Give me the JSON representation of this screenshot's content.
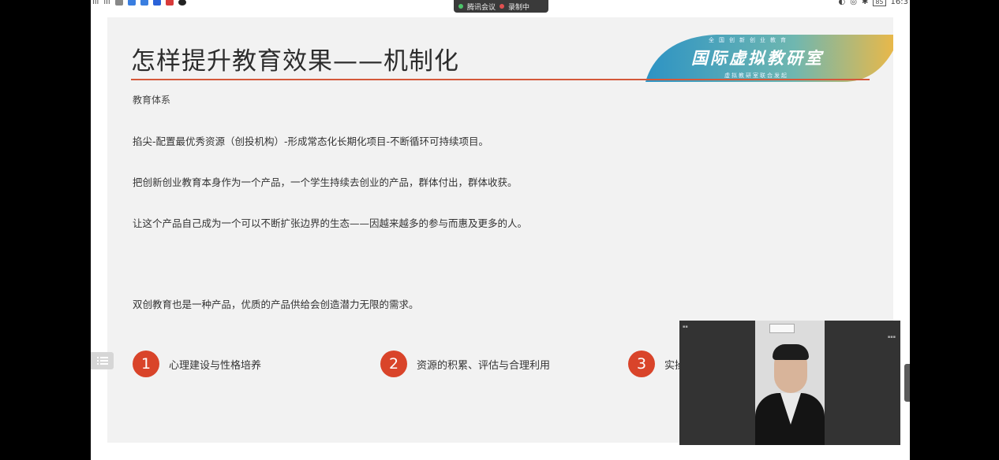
{
  "statusbar": {
    "left_signal": "ıll",
    "left_signal2": "ıll",
    "meeting_app": "腾讯会议",
    "recording": "录制中",
    "battery": "85",
    "time": "16:3"
  },
  "slide": {
    "title": "怎样提升教育效果——机制化",
    "banner": {
      "main": "国际虚拟教研室",
      "top": "全国创新创业教育",
      "bottom": "虚拟教研室联合发起"
    },
    "heading": "教育体系",
    "paragraphs": [
      "掐尖-配置最优秀资源（创投机构）-形成常态化长期化项目-不断循环可持续项目。",
      "把创新创业教育本身作为一个产品，一个学生持续去创业的产品，群体付出，群体收获。",
      "让这个产品自己成为一个可以不断扩张边界的生态——因越来越多的参与而惠及更多的人。",
      "双创教育也是一种产品，优质的产品供给会创造潜力无限的需求。"
    ],
    "points": [
      {
        "num": "1",
        "label": "心理建设与性格培养"
      },
      {
        "num": "2",
        "label": "资源的积累、评估与合理利用"
      },
      {
        "num": "3",
        "label": "实操"
      }
    ]
  },
  "colors": {
    "accent": "#d9442a",
    "rule": "#d4583a",
    "banner_start": "#3aa0c8",
    "banner_end": "#e8b84a"
  }
}
